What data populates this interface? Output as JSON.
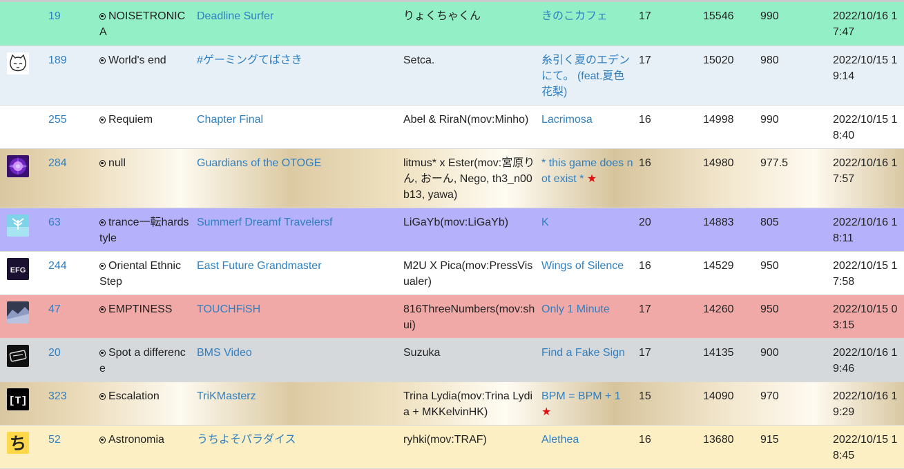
{
  "rows": [
    {
      "icon": "",
      "bg": "green",
      "id": "19",
      "genre": "NOISETRONICA",
      "title": "Deadline Surfer",
      "artist": "りょくちゃくん",
      "bms": "きのこカフェ",
      "bms_star": "",
      "level": "17",
      "score": "15546",
      "pts": "990",
      "date": "2022/10/16 17:47"
    },
    {
      "icon": "cat-face-icon",
      "bg": "lightblue",
      "id": "189",
      "genre": "World's end",
      "title": "#ゲーミングてばさき",
      "artist": "Setca.",
      "bms": "糸引く夏のエデンにて。 (feat.夏色花梨)",
      "bms_star": "",
      "level": "17",
      "score": "15020",
      "pts": "980",
      "date": "2022/10/15 19:14"
    },
    {
      "icon": "",
      "bg": "white",
      "id": "255",
      "genre": "Requiem",
      "title": "Chapter Final",
      "artist": "Abel & RiraN(mov:Minho)",
      "bms": "Lacrimosa",
      "bms_star": "",
      "level": "16",
      "score": "14998",
      "pts": "990",
      "date": "2022/10/15 18:40"
    },
    {
      "icon": "purple-burst-icon",
      "bg": "gold",
      "id": "284",
      "genre": "null",
      "title": "Guardians of the OTOGE",
      "artist": "litmus* x Ester(mov:宮原りん, おーん, Nego, th3_n00b13, yawa)",
      "bms": "* this game does not exist *",
      "bms_star": "★",
      "level": "16",
      "score": "14980",
      "pts": "977.5",
      "date": "2022/10/16 17:57"
    },
    {
      "icon": "white-bird-icon",
      "bg": "lavender",
      "id": "63",
      "genre": "trance一転hardstyle",
      "title": "Summerf Dreamf Travelersf",
      "artist": "LiGaYb(mov:LiGaYb)",
      "bms": "K",
      "bms_star": "",
      "level": "20",
      "score": "14883",
      "pts": "805",
      "date": "2022/10/16 18:11"
    },
    {
      "icon": "efg-logo-icon",
      "bg": "white",
      "id": "244",
      "genre": "Oriental Ethnic Step",
      "title": "East Future Grandmaster",
      "artist": "M2U X Pica(mov:PressVisualer)",
      "bms": "Wings of Silence",
      "bms_star": "",
      "level": "16",
      "score": "14529",
      "pts": "950",
      "date": "2022/10/15 17:58"
    },
    {
      "icon": "landscape-icon",
      "bg": "red",
      "id": "47",
      "genre": "EMPTINESS",
      "title": "TOUCHFiSH",
      "artist": "816ThreeNumbers(mov:shui)",
      "bms": "Only 1 Minute",
      "bms_star": "",
      "level": "17",
      "score": "14260",
      "pts": "950",
      "date": "2022/10/15 03:15"
    },
    {
      "icon": "dark-sign-icon",
      "bg": "gray",
      "id": "20",
      "genre": "Spot a difference",
      "title": "BMS Video",
      "artist": "Suzuka",
      "bms": "Find a Fake Sign",
      "bms_star": "",
      "level": "17",
      "score": "14135",
      "pts": "900",
      "date": "2022/10/16 19:46"
    },
    {
      "icon": "trikmasterz-logo-icon",
      "bg": "gold",
      "id": "323",
      "genre": "Escalation",
      "title": "TriKMasterz",
      "artist": "Trina Lydia(mov:Trina Lydia + MKKelvinHK)",
      "bms": "BPM = BPM + 1",
      "bms_star": "★",
      "level": "15",
      "score": "14090",
      "pts": "970",
      "date": "2022/10/16 19:29"
    },
    {
      "icon": "chi-kana-icon",
      "bg": "cream",
      "id": "52",
      "genre": "Astronomia",
      "title": "うちよそパラダイス",
      "artist": "ryhki(mov:TRAF)",
      "bms": "Alethea",
      "bms_star": "",
      "level": "16",
      "score": "13680",
      "pts": "915",
      "date": "2022/10/15 18:45"
    }
  ],
  "icon_glyphs": {
    "trikmasterz-logo": "[T]",
    "efg-logo": "EFG",
    "chi-kana": "ち"
  }
}
